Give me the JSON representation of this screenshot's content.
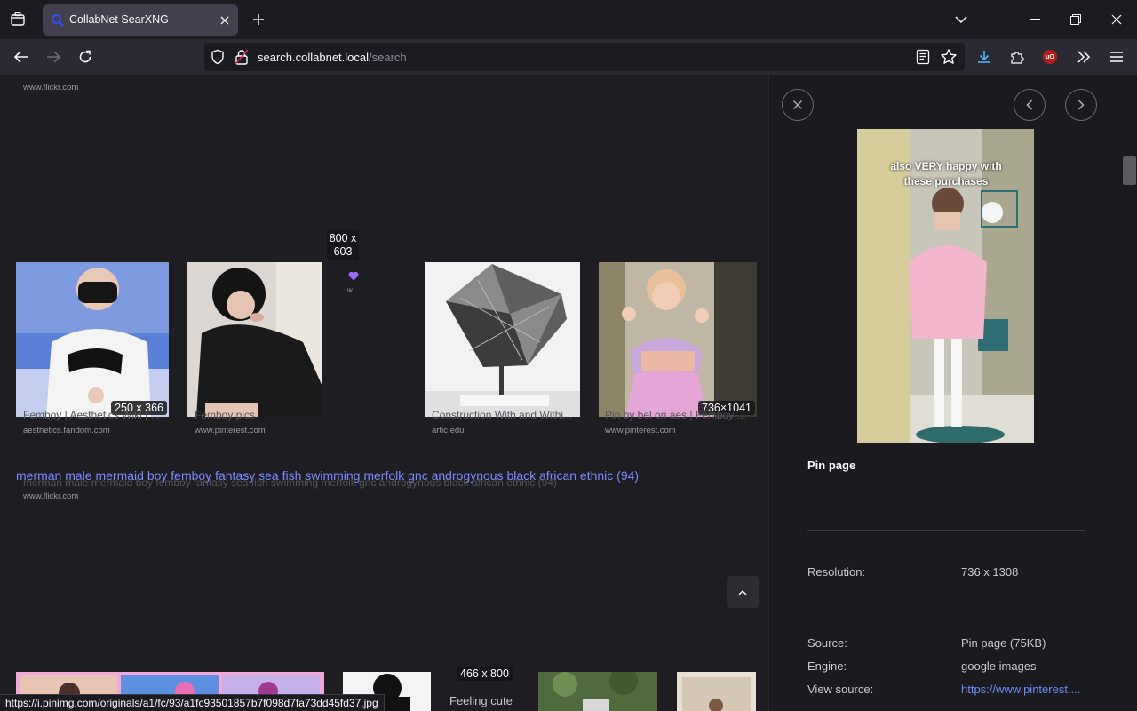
{
  "browser": {
    "tab_title": "CollabNet SearXNG",
    "url_host": "search.collabnet.local",
    "url_path": "/search",
    "status_url": "https://i.pinimg.com/originals/a1/fc/93/a1fc93501857b7f098d7fa73dd45fd37.jpg"
  },
  "results": {
    "top_domain": "www.flickr.com",
    "row1": [
      {
        "title": "Femboy | Aesthetics Wiki | ...",
        "domain": "aesthetics.fandom.com",
        "dims": "250 x 366"
      },
      {
        "title": "Femboy pics",
        "domain": "www.pinterest.com",
        "dims": ""
      },
      {
        "title": "",
        "domain": "w...",
        "dims": ""
      },
      {
        "title": "Construction With and Withi...",
        "domain": "artic.edu",
        "dims": ""
      },
      {
        "title": "Pin by bel on aes | Femboy ...",
        "domain": "www.pinterest.com",
        "dims": "736×1041"
      }
    ],
    "tooltip": "800 x 603",
    "heading_link": "merman male mermaid boy femboy fantasy sea fish swimming merfolk gnc androgynous black african ethnic (94)",
    "heading_title": "merman male mermaid boy femboy fantasy sea fish swimming merfolk gnc androgynous black african ethnic (94)",
    "heading_domain": "www.flickr.com",
    "row2": [
      {
        "dims": "466 x 800",
        "title": "Feeling cute"
      }
    ]
  },
  "detail": {
    "image_caption": "also VERY happy with these purchases",
    "title": "Pin page",
    "resolution_label": "Resolution:",
    "resolution_value": "736 x 1308",
    "source_label": "Source:",
    "source_value": "Pin page (75KB)",
    "engine_label": "Engine:",
    "engine_value": "google images",
    "view_source_label": "View source:",
    "view_source_value": "https://www.pinterest...."
  },
  "colors": {
    "accent_link": "#7d8cff",
    "background": "#1d1d22",
    "panel": "#1b1b1f"
  }
}
